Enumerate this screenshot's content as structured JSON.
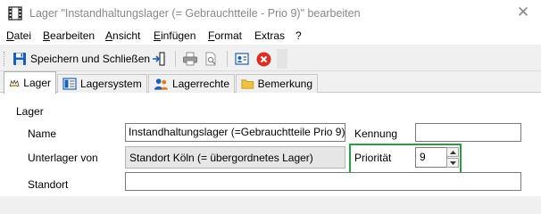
{
  "window": {
    "title": "Lager \"Instandhaltungslager (= Gebrauchtteile - Prio 9)\" bearbeiten",
    "icon": "film-strip-icon",
    "close_glyph": "✕"
  },
  "menu": {
    "items": [
      {
        "accel": "D",
        "rest": "atei"
      },
      {
        "accel": "B",
        "rest": "earbeiten"
      },
      {
        "accel": "A",
        "rest": "nsicht"
      },
      {
        "accel": "E",
        "rest": "infügen"
      },
      {
        "accel": "F",
        "rest": "ormat"
      },
      {
        "accel": "",
        "rest": "Extras"
      },
      {
        "accel": "",
        "rest": "?"
      }
    ]
  },
  "toolbar": {
    "save_close_label": "Speichern und Schließen"
  },
  "tabs": [
    {
      "label": "Lager",
      "icon": "warehouse-icon",
      "active": true
    },
    {
      "label": "Lagersystem",
      "icon": "layout-icon",
      "active": false
    },
    {
      "label": "Lagerrechte",
      "icon": "users-icon",
      "active": false
    },
    {
      "label": "Bemerkung",
      "icon": "folder-icon",
      "active": false
    }
  ],
  "form": {
    "group_title": "Lager",
    "name_label": "Name",
    "name_value": "Instandhaltungslager (=Gebrauchtteile Prio 9)",
    "kennung_label": "Kennung",
    "kennung_value": "",
    "unterlager_label": "Unterlager von",
    "unterlager_value": "Standort Köln (= übergordnetes Lager)",
    "prioritaet_label": "Priorität",
    "prioritaet_value": "9",
    "standort_label": "Standort",
    "standort_value": ""
  },
  "colors": {
    "highlight": "#2d9a45",
    "close_icon": "#d93025",
    "save_icon": "#1a5fb4"
  }
}
